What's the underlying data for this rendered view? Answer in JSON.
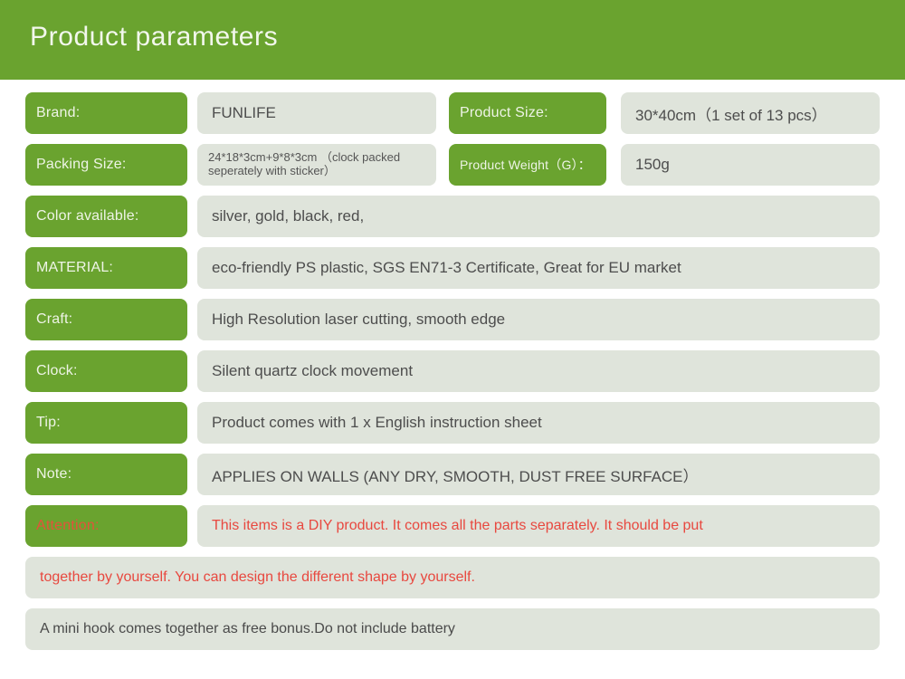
{
  "header": {
    "title": "Product parameters",
    "background_color": "#6AA32F",
    "title_color": "#F2F7EC"
  },
  "theme": {
    "pill_green": "#6AA32F",
    "value_grey": "#DFE4DB",
    "text_grey": "#4D4D4D",
    "attention_red": "#E8483F"
  },
  "rows": [
    {
      "label": "Brand:",
      "value": "FUNLIFE",
      "label2": "Product Size:",
      "value2": "30*40cm（1 set of 13 pcs）"
    },
    {
      "label": "Packing Size:",
      "value": "24*18*3cm+9*8*3cm （clock packed seperately with sticker）",
      "label2": "Product Weight（G）：",
      "value2": "150g"
    },
    {
      "label": "Color available:",
      "value": "silver, gold, black, red,"
    },
    {
      "label": "MATERIAL:",
      "value": "eco-friendly PS plastic, SGS EN71-3 Certificate, Great for EU market"
    },
    {
      "label": "Craft:",
      "value": "High Resolution laser cutting, smooth edge"
    },
    {
      "label": "Clock:",
      "value": "Silent quartz clock movement"
    },
    {
      "label": "Tip:",
      "value": "Product comes with 1 x English instruction sheet"
    },
    {
      "label": "Note:",
      "value": "APPLIES ON WALLS (ANY DRY, SMOOTH, DUST FREE SURFACE）"
    },
    {
      "label": "Attention:",
      "value": "This items is a DIY product. It comes all the parts separately. It should be put"
    }
  ],
  "footer_rows": [
    {
      "text": "together by yourself. You can design the different shape by yourself.",
      "color": "red"
    },
    {
      "text": "A mini hook comes together as free bonus.Do not include battery",
      "color": "grey"
    }
  ]
}
